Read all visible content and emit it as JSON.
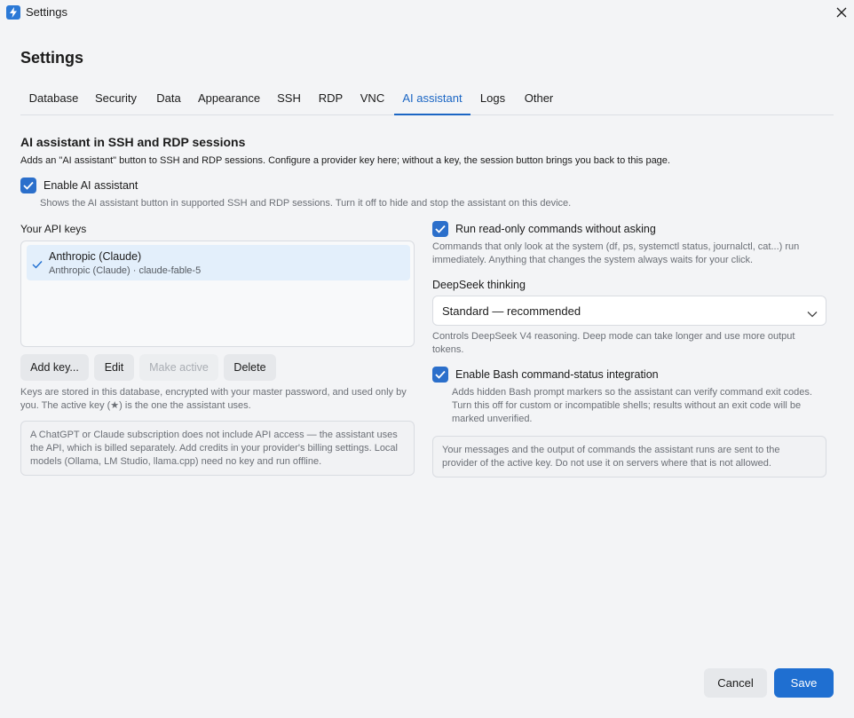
{
  "window": {
    "title": "Settings",
    "app_icon": "lightning-icon",
    "close_icon": "close-icon"
  },
  "page_title": "Settings",
  "tabs": [
    {
      "label": "Database"
    },
    {
      "label": "Security"
    },
    {
      "label": "Data"
    },
    {
      "label": "Appearance"
    },
    {
      "label": "SSH"
    },
    {
      "label": "RDP"
    },
    {
      "label": "VNC"
    },
    {
      "label": "AI assistant",
      "active": true
    },
    {
      "label": "Logs"
    },
    {
      "label": "Other"
    }
  ],
  "section": {
    "title": "AI assistant in SSH and RDP sessions",
    "description": "Adds an \"AI assistant\" button to SSH and RDP sessions. Configure a provider key here; without a key, the session button brings you back to this page."
  },
  "enable_assistant": {
    "label": "Enable AI assistant",
    "checked": true,
    "hint": "Shows the AI assistant button in supported SSH and RDP sessions. Turn it off to hide and stop the assistant on this device."
  },
  "api_keys": {
    "label": "Your API keys",
    "items": [
      {
        "name": "Anthropic (Claude)",
        "detail": "Anthropic (Claude) · claude-fable-5",
        "active": true
      }
    ],
    "buttons": {
      "add": "Add key...",
      "edit": "Edit",
      "make_active": "Make active",
      "delete": "Delete"
    },
    "storage_note": "Keys are stored in this database, encrypted with your master password, and used only by you. The active key (★) is the one the assistant uses.",
    "subscription_note": "A ChatGPT or Claude subscription does not include API access — the assistant uses the API, which is billed separately. Add credits in your provider's billing settings. Local models (Ollama, LM Studio, llama.cpp) need no key and run offline."
  },
  "read_only": {
    "label": "Run read-only commands without asking",
    "checked": true,
    "hint": "Commands that only look at the system (df, ps, systemctl status, journalctl, cat...) run immediately. Anything that changes the system always waits for your click."
  },
  "deepseek": {
    "label": "DeepSeek thinking",
    "value": "Standard — recommended",
    "hint": "Controls DeepSeek V4 reasoning. Deep mode can take longer and use more output tokens."
  },
  "bash_integration": {
    "label": "Enable Bash command-status integration",
    "checked": true,
    "hint": "Adds hidden Bash prompt markers so the assistant can verify command exit codes. Turn this off for custom or incompatible shells; results without an exit code will be marked unverified."
  },
  "privacy_note": "Your messages and the output of commands the assistant runs are sent to the provider of the active key. Do not use it on servers where that is not allowed.",
  "footer": {
    "cancel": "Cancel",
    "save": "Save"
  },
  "colors": {
    "accent": "#1f6fd1",
    "background": "#f3f4f6"
  }
}
